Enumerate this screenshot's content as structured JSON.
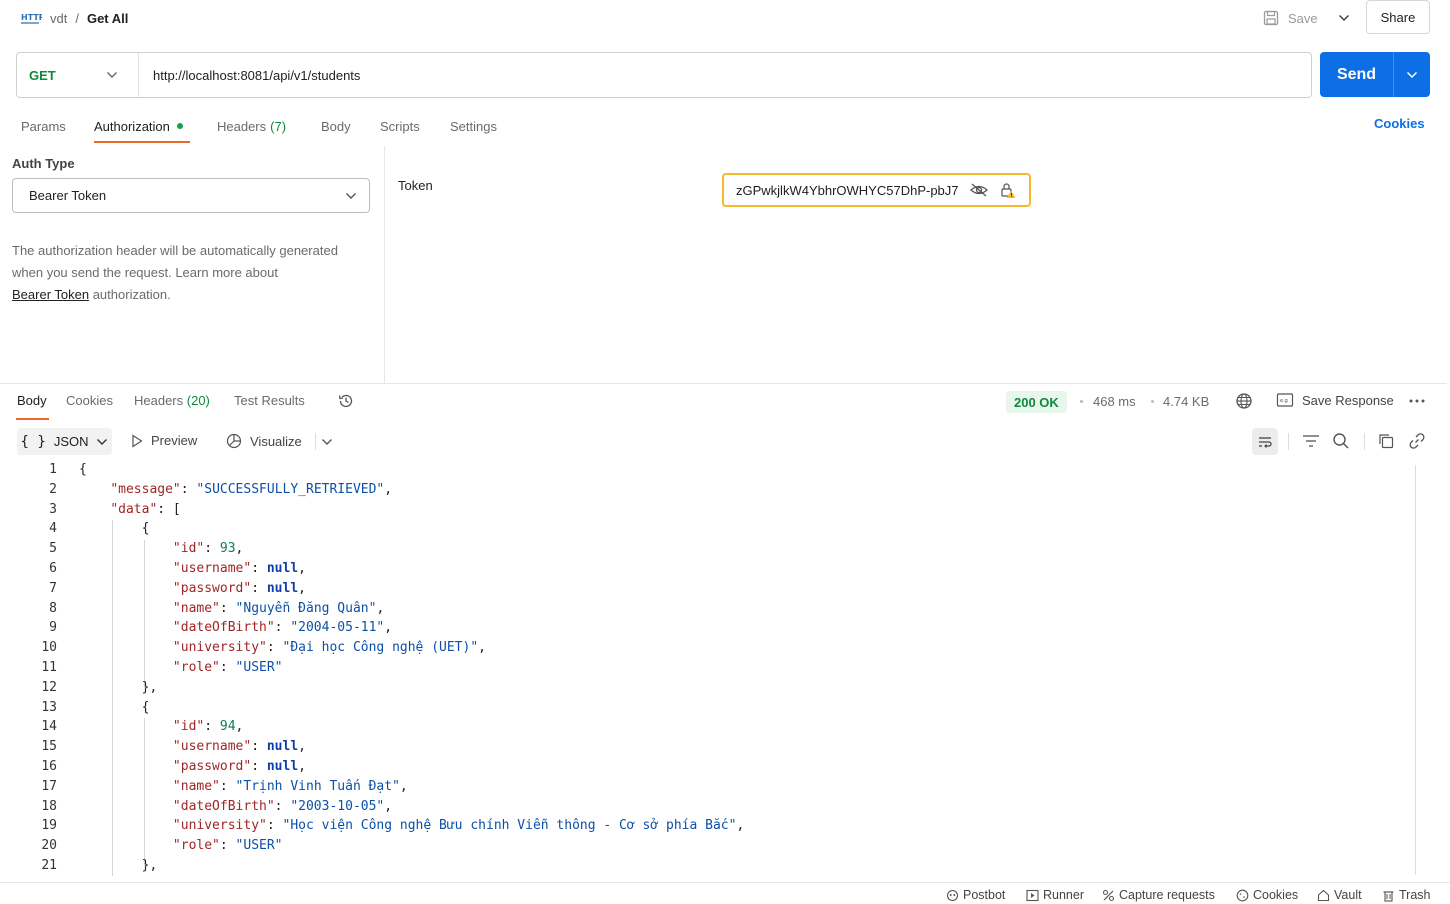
{
  "header": {
    "workspace": "vdt",
    "separator": "/",
    "request_name": "Get All",
    "save_label": "Save",
    "share_label": "Share"
  },
  "request": {
    "method": "GET",
    "url": "http://localhost:8081/api/v1/students",
    "send_label": "Send"
  },
  "tabs": {
    "params": "Params",
    "authorization": "Authorization",
    "headers": "Headers",
    "headers_count": "(7)",
    "body": "Body",
    "scripts": "Scripts",
    "settings": "Settings",
    "cookies": "Cookies"
  },
  "auth": {
    "type_label": "Auth Type",
    "type_value": "Bearer Token",
    "desc_1": "The authorization header will be automatically generated",
    "desc_2": "when you send the request. Learn more about",
    "desc_link": "Bearer Token",
    "desc_3": " authorization.",
    "token_label": "Token",
    "token_value": "zGPwkjlkW4YbhrOWHYC57DhP-pbJ7"
  },
  "response": {
    "tabs": {
      "body": "Body",
      "cookies": "Cookies",
      "headers": "Headers",
      "headers_count": "(20)",
      "test_results": "Test Results"
    },
    "status": "200 OK",
    "time": "468 ms",
    "size": "4.74 KB",
    "save_response": "Save Response",
    "format": "JSON",
    "preview": "Preview",
    "visualize": "Visualize",
    "lines": [
      "{",
      "    \"message\": \"SUCCESSFULLY_RETRIEVED\",",
      "    \"data\": [",
      "        {",
      "            \"id\": 93,",
      "            \"username\": null,",
      "            \"password\": null,",
      "            \"name\": \"Nguyễn Đăng Quân\",",
      "            \"dateOfBirth\": \"2004-05-11\",",
      "            \"university\": \"Đại học Công nghệ (UET)\",",
      "            \"role\": \"USER\"",
      "        },",
      "        {",
      "            \"id\": 94,",
      "            \"username\": null,",
      "            \"password\": null,",
      "            \"name\": \"Trịnh Vinh Tuấn Đạt\",",
      "            \"dateOfBirth\": \"2003-10-05\",",
      "            \"university\": \"Học viện Công nghệ Bưu chính Viễn thông - Cơ sở phía Bắc\",",
      "            \"role\": \"USER\"",
      "        },"
    ]
  },
  "statusbar": {
    "postbot": "Postbot",
    "runner": "Runner",
    "capture": "Capture requests",
    "cookies": "Cookies",
    "vault": "Vault",
    "trash": "Trash"
  },
  "colors": {
    "accent": "#0d6fe6",
    "tab_underline": "#e8692c",
    "success": "#0e8a3c",
    "token_border": "#f5b82e"
  }
}
